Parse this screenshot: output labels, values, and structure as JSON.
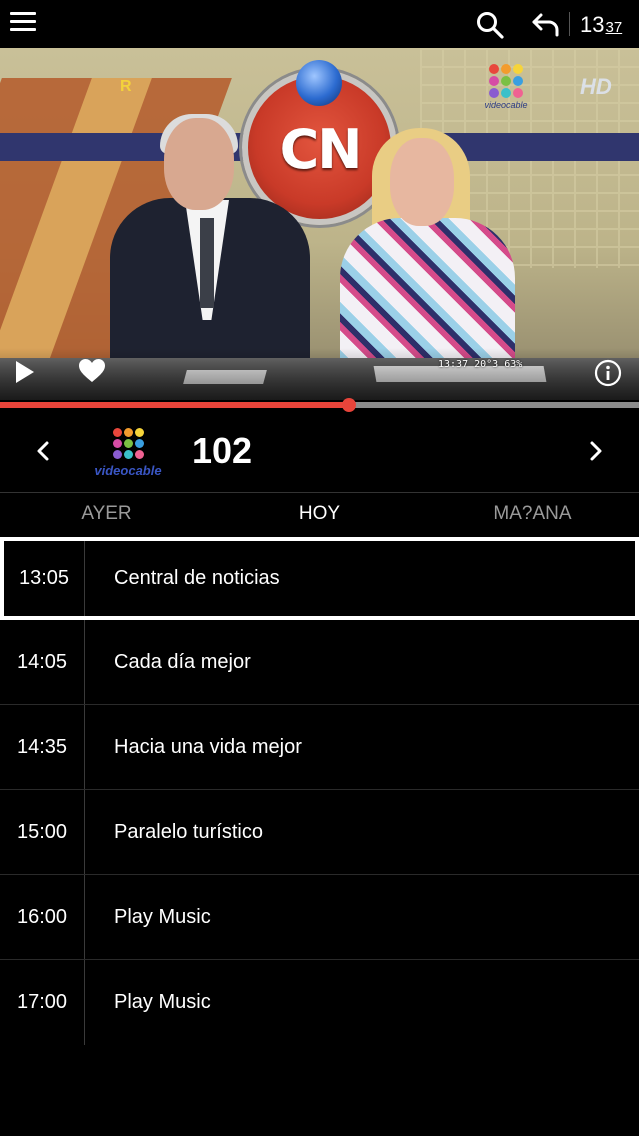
{
  "header": {
    "clock_hour": "13",
    "clock_minute": "37",
    "icons": [
      "menu-icon",
      "search-icon",
      "back-icon"
    ]
  },
  "video": {
    "osd_text": "13:37  20°3 63%",
    "corner_mark": "R",
    "hd_mark": "HD",
    "channel_brand": "videocable",
    "logo_text": "CN",
    "progress_fraction": 0.546,
    "icons": [
      "play-icon",
      "heart-icon",
      "info-icon"
    ]
  },
  "channel": {
    "logo_label": "videocable",
    "number": "102"
  },
  "tabs": [
    {
      "label": "AYER",
      "active": false
    },
    {
      "label": "HOY",
      "active": true
    },
    {
      "label": "MA?ANA",
      "active": false
    }
  ],
  "schedule": [
    {
      "time": "13:05",
      "title": "Central de noticias",
      "selected": true
    },
    {
      "time": "14:05",
      "title": "Cada día mejor",
      "selected": false
    },
    {
      "time": "14:35",
      "title": "Hacia una vida mejor",
      "selected": false
    },
    {
      "time": "15:00",
      "title": "Paralelo turístico",
      "selected": false
    },
    {
      "time": "16:00",
      "title": "Play Music",
      "selected": false
    },
    {
      "time": "17:00",
      "title": "Play Music",
      "selected": false
    }
  ],
  "colors": {
    "accent": "#e8443a",
    "background": "#000000",
    "logo_dots": [
      "#e8473c",
      "#f39c2d",
      "#f6d43a",
      "#d64ca5",
      "#7bc043",
      "#3a9fe0",
      "#8a5cd0",
      "#3ac0c9",
      "#f06292"
    ]
  }
}
